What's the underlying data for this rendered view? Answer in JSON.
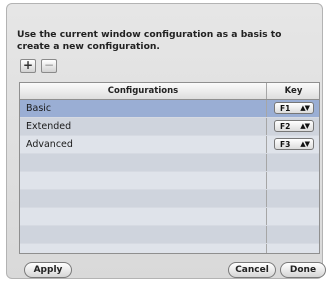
{
  "instruction": "Use the current window configuration as a basis to create a new configuration.",
  "toolbar": {
    "add_label": "+",
    "remove_label": "−"
  },
  "table": {
    "headers": {
      "configurations": "Configurations",
      "key": "Key"
    },
    "rows": [
      {
        "name": "Basic",
        "key": "F1",
        "selected": true
      },
      {
        "name": "Extended",
        "key": "F2",
        "selected": false
      },
      {
        "name": "Advanced",
        "key": "F3",
        "selected": false
      }
    ],
    "empty_row_count": 7,
    "popup_arrows": "▲▼"
  },
  "buttons": {
    "apply": "Apply",
    "cancel": "Cancel",
    "done": "Done"
  }
}
